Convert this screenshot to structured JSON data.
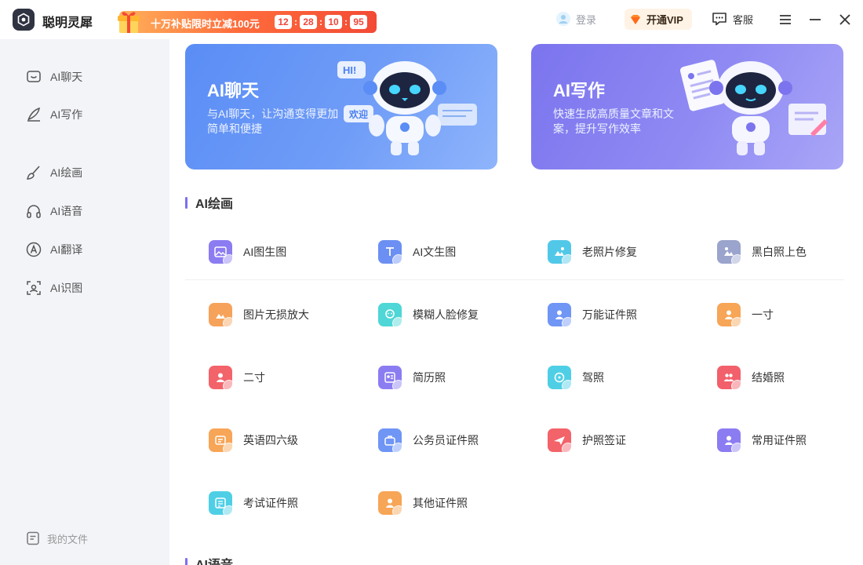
{
  "app": {
    "title": "聪明灵犀"
  },
  "promo": {
    "text": "十万补贴限时立减100元",
    "countdown": [
      "12",
      "28",
      "10",
      "95"
    ],
    "separator": ":"
  },
  "header": {
    "login_label": "登录",
    "vip_label": "开通VIP",
    "service_label": "客服"
  },
  "sidebar": {
    "items": [
      {
        "label": "AI聊天",
        "icon": "chat-icon"
      },
      {
        "label": "AI写作",
        "icon": "pen-icon"
      },
      {
        "label": "AI绘画",
        "icon": "brush-icon"
      },
      {
        "label": "AI语音",
        "icon": "headphone-icon"
      },
      {
        "label": "AI翻译",
        "icon": "translate-icon"
      },
      {
        "label": "AI识图",
        "icon": "scan-icon"
      }
    ],
    "bottom_label": "我的文件"
  },
  "banners": [
    {
      "title": "AI聊天",
      "desc": "与AI聊天，让沟通变得更加简单和便捷",
      "bubbles": [
        "HI!",
        "欢迎"
      ]
    },
    {
      "title": "AI写作",
      "desc": "快速生成高质量文章和文案，提升写作效率"
    }
  ],
  "sections": {
    "drawing_title": "AI绘画",
    "voice_title": "AI语音"
  },
  "tools": [
    {
      "label": "AI图生图",
      "color": "#8b7cf2"
    },
    {
      "label": "AI文生图",
      "color": "#6c8ff3"
    },
    {
      "label": "老照片修复",
      "color": "#52c8e8"
    },
    {
      "label": "黑白照上色",
      "color": "#9aa4cc"
    },
    {
      "label": "图片无损放大",
      "color": "#f6a25a"
    },
    {
      "label": "模糊人脸修复",
      "color": "#4fd6d6"
    },
    {
      "label": "万能证件照",
      "color": "#6f95f5"
    },
    {
      "label": "一寸",
      "color": "#f7a556"
    },
    {
      "label": "二寸",
      "color": "#f3636a"
    },
    {
      "label": "简历照",
      "color": "#8b7cf2"
    },
    {
      "label": "驾照",
      "color": "#4fcfe6"
    },
    {
      "label": "结婚照",
      "color": "#f2606c"
    },
    {
      "label": "英语四六级",
      "color": "#f7a556"
    },
    {
      "label": "公务员证件照",
      "color": "#6f95f5"
    },
    {
      "label": "护照签证",
      "color": "#f3636a"
    },
    {
      "label": "常用证件照",
      "color": "#8b7cf2"
    },
    {
      "label": "考试证件照",
      "color": "#4fcfe6"
    },
    {
      "label": "其他证件照",
      "color": "#f7a556"
    }
  ],
  "colors": {
    "accent": "#7b6ff0",
    "promo": "#f34a35",
    "chat_banner": "#5a8df5",
    "write_banner": "#7b74ee"
  }
}
